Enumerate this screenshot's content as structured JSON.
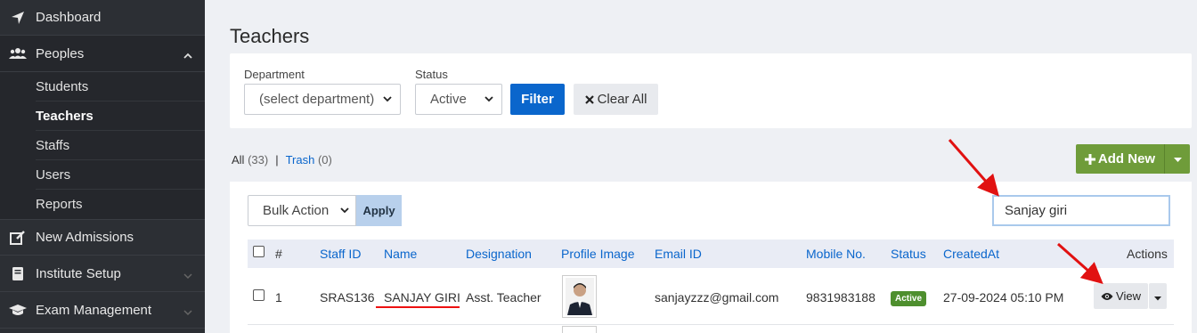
{
  "sidebar": {
    "dashboard": "Dashboard",
    "peoples": "Peoples",
    "sub_items": [
      "Students",
      "Teachers",
      "Staffs",
      "Users",
      "Reports"
    ],
    "new_admissions": "New Admissions",
    "institute_setup": "Institute Setup",
    "exam_management": "Exam Management"
  },
  "page": {
    "title": "Teachers"
  },
  "filters": {
    "department_label": "Department",
    "department_value": "(select department)",
    "status_label": "Status",
    "status_value": "Active",
    "filter_button": "Filter",
    "clear_button": "Clear All"
  },
  "tabs": {
    "all_label": "All",
    "all_count": "(33)",
    "separator": "|",
    "trash_label": "Trash",
    "trash_count": "(0)"
  },
  "add_new": {
    "label": "Add New"
  },
  "toolbar": {
    "bulk_action": "Bulk Action",
    "apply": "Apply",
    "search_value": "Sanjay giri"
  },
  "table": {
    "headers": [
      "#",
      "Staff ID",
      "Name",
      "Designation",
      "Profile Image",
      "Email ID",
      "Mobile No.",
      "Status",
      "CreatedAt",
      "Actions"
    ],
    "rows": [
      {
        "num": "1",
        "staff_id": "SRAS136",
        "name": "SANJAY GIRI",
        "designation": "Asst. Teacher",
        "email": "sanjayzzz@gmail.com",
        "mobile": "9831983188",
        "status": "Active",
        "created_at": "27-09-2024 05:10 PM",
        "view_label": "View"
      }
    ]
  },
  "colors": {
    "sidebar_bg": "#2c2f34",
    "primary": "#0a66cc",
    "success": "#6f9c3a",
    "status_badge": "#4e8f2e",
    "annotation": "#e11111"
  }
}
